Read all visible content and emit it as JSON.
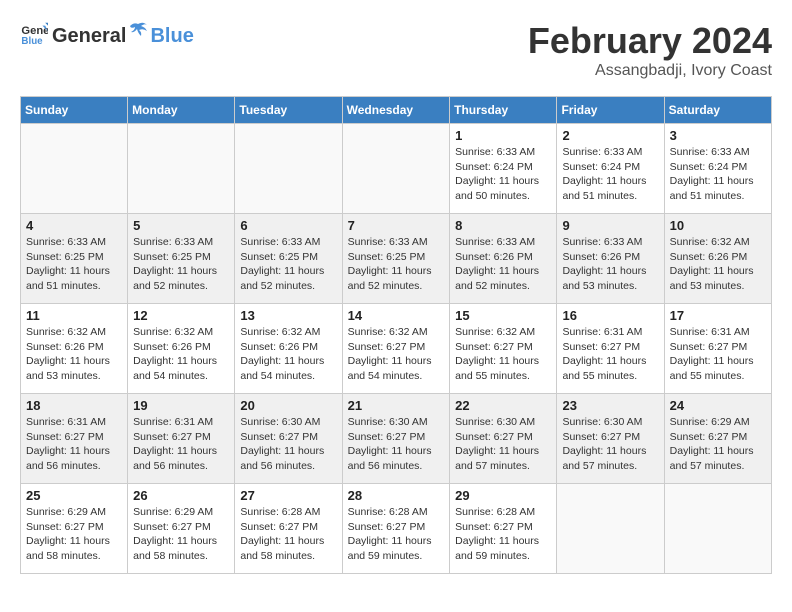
{
  "logo": {
    "text_general": "General",
    "text_blue": "Blue"
  },
  "header": {
    "month_year": "February 2024",
    "location": "Assangbadji, Ivory Coast"
  },
  "days_of_week": [
    "Sunday",
    "Monday",
    "Tuesday",
    "Wednesday",
    "Thursday",
    "Friday",
    "Saturday"
  ],
  "weeks": [
    [
      {
        "day": "",
        "info": ""
      },
      {
        "day": "",
        "info": ""
      },
      {
        "day": "",
        "info": ""
      },
      {
        "day": "",
        "info": ""
      },
      {
        "day": "1",
        "info": "Sunrise: 6:33 AM\nSunset: 6:24 PM\nDaylight: 11 hours\nand 50 minutes."
      },
      {
        "day": "2",
        "info": "Sunrise: 6:33 AM\nSunset: 6:24 PM\nDaylight: 11 hours\nand 51 minutes."
      },
      {
        "day": "3",
        "info": "Sunrise: 6:33 AM\nSunset: 6:24 PM\nDaylight: 11 hours\nand 51 minutes."
      }
    ],
    [
      {
        "day": "4",
        "info": "Sunrise: 6:33 AM\nSunset: 6:25 PM\nDaylight: 11 hours\nand 51 minutes."
      },
      {
        "day": "5",
        "info": "Sunrise: 6:33 AM\nSunset: 6:25 PM\nDaylight: 11 hours\nand 52 minutes."
      },
      {
        "day": "6",
        "info": "Sunrise: 6:33 AM\nSunset: 6:25 PM\nDaylight: 11 hours\nand 52 minutes."
      },
      {
        "day": "7",
        "info": "Sunrise: 6:33 AM\nSunset: 6:25 PM\nDaylight: 11 hours\nand 52 minutes."
      },
      {
        "day": "8",
        "info": "Sunrise: 6:33 AM\nSunset: 6:26 PM\nDaylight: 11 hours\nand 52 minutes."
      },
      {
        "day": "9",
        "info": "Sunrise: 6:33 AM\nSunset: 6:26 PM\nDaylight: 11 hours\nand 53 minutes."
      },
      {
        "day": "10",
        "info": "Sunrise: 6:32 AM\nSunset: 6:26 PM\nDaylight: 11 hours\nand 53 minutes."
      }
    ],
    [
      {
        "day": "11",
        "info": "Sunrise: 6:32 AM\nSunset: 6:26 PM\nDaylight: 11 hours\nand 53 minutes."
      },
      {
        "day": "12",
        "info": "Sunrise: 6:32 AM\nSunset: 6:26 PM\nDaylight: 11 hours\nand 54 minutes."
      },
      {
        "day": "13",
        "info": "Sunrise: 6:32 AM\nSunset: 6:26 PM\nDaylight: 11 hours\nand 54 minutes."
      },
      {
        "day": "14",
        "info": "Sunrise: 6:32 AM\nSunset: 6:27 PM\nDaylight: 11 hours\nand 54 minutes."
      },
      {
        "day": "15",
        "info": "Sunrise: 6:32 AM\nSunset: 6:27 PM\nDaylight: 11 hours\nand 55 minutes."
      },
      {
        "day": "16",
        "info": "Sunrise: 6:31 AM\nSunset: 6:27 PM\nDaylight: 11 hours\nand 55 minutes."
      },
      {
        "day": "17",
        "info": "Sunrise: 6:31 AM\nSunset: 6:27 PM\nDaylight: 11 hours\nand 55 minutes."
      }
    ],
    [
      {
        "day": "18",
        "info": "Sunrise: 6:31 AM\nSunset: 6:27 PM\nDaylight: 11 hours\nand 56 minutes."
      },
      {
        "day": "19",
        "info": "Sunrise: 6:31 AM\nSunset: 6:27 PM\nDaylight: 11 hours\nand 56 minutes."
      },
      {
        "day": "20",
        "info": "Sunrise: 6:30 AM\nSunset: 6:27 PM\nDaylight: 11 hours\nand 56 minutes."
      },
      {
        "day": "21",
        "info": "Sunrise: 6:30 AM\nSunset: 6:27 PM\nDaylight: 11 hours\nand 56 minutes."
      },
      {
        "day": "22",
        "info": "Sunrise: 6:30 AM\nSunset: 6:27 PM\nDaylight: 11 hours\nand 57 minutes."
      },
      {
        "day": "23",
        "info": "Sunrise: 6:30 AM\nSunset: 6:27 PM\nDaylight: 11 hours\nand 57 minutes."
      },
      {
        "day": "24",
        "info": "Sunrise: 6:29 AM\nSunset: 6:27 PM\nDaylight: 11 hours\nand 57 minutes."
      }
    ],
    [
      {
        "day": "25",
        "info": "Sunrise: 6:29 AM\nSunset: 6:27 PM\nDaylight: 11 hours\nand 58 minutes."
      },
      {
        "day": "26",
        "info": "Sunrise: 6:29 AM\nSunset: 6:27 PM\nDaylight: 11 hours\nand 58 minutes."
      },
      {
        "day": "27",
        "info": "Sunrise: 6:28 AM\nSunset: 6:27 PM\nDaylight: 11 hours\nand 58 minutes."
      },
      {
        "day": "28",
        "info": "Sunrise: 6:28 AM\nSunset: 6:27 PM\nDaylight: 11 hours\nand 59 minutes."
      },
      {
        "day": "29",
        "info": "Sunrise: 6:28 AM\nSunset: 6:27 PM\nDaylight: 11 hours\nand 59 minutes."
      },
      {
        "day": "",
        "info": ""
      },
      {
        "day": "",
        "info": ""
      }
    ]
  ]
}
